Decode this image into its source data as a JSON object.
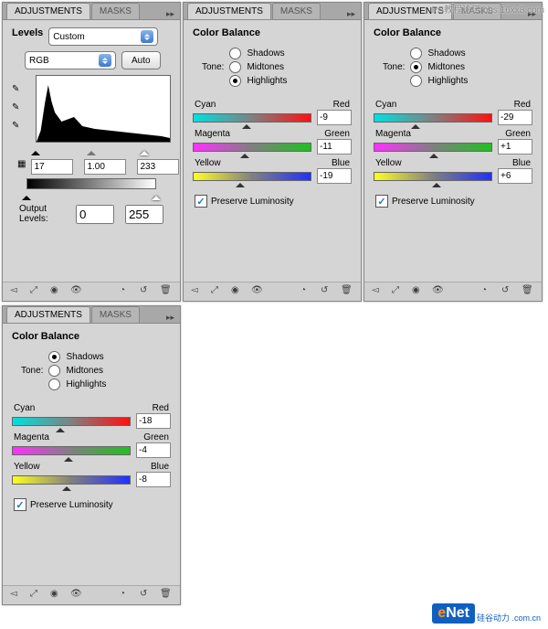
{
  "tabs": {
    "adjustments": "ADJUSTMENTS",
    "masks": "MASKS"
  },
  "panels": {
    "levels": {
      "title": "Levels",
      "preset": "Custom",
      "channel": "RGB",
      "auto": "Auto",
      "input": {
        "black": "17",
        "mid": "1.00",
        "white": "233"
      },
      "output_label": "Output Levels:",
      "output": {
        "black": "0",
        "white": "255"
      }
    },
    "cb_highlights": {
      "title": "Color Balance",
      "tone_label": "Tone:",
      "tones": {
        "shadows": "Shadows",
        "midtones": "Midtones",
        "highlights": "Highlights",
        "selected": "highlights"
      },
      "sliders": {
        "cr": {
          "left": "Cyan",
          "right": "Red",
          "value": "-9"
        },
        "mg": {
          "left": "Magenta",
          "right": "Green",
          "value": "-11"
        },
        "yb": {
          "left": "Yellow",
          "right": "Blue",
          "value": "-19"
        }
      },
      "preserve": "Preserve Luminosity"
    },
    "cb_midtones": {
      "title": "Color Balance",
      "tone_label": "Tone:",
      "tones": {
        "shadows": "Shadows",
        "midtones": "Midtones",
        "highlights": "Highlights",
        "selected": "midtones"
      },
      "sliders": {
        "cr": {
          "left": "Cyan",
          "right": "Red",
          "value": "-29"
        },
        "mg": {
          "left": "Magenta",
          "right": "Green",
          "value": "+1"
        },
        "yb": {
          "left": "Yellow",
          "right": "Blue",
          "value": "+6"
        }
      },
      "preserve": "Preserve Luminosity"
    },
    "cb_shadows": {
      "title": "Color Balance",
      "tone_label": "Tone:",
      "tones": {
        "shadows": "Shadows",
        "midtones": "Midtones",
        "highlights": "Highlights",
        "selected": "shadows"
      },
      "sliders": {
        "cr": {
          "left": "Cyan",
          "right": "Red",
          "value": "-18"
        },
        "mg": {
          "left": "Magenta",
          "right": "Green",
          "value": "-4"
        },
        "yb": {
          "left": "Yellow",
          "right": "Blue",
          "value": "-8"
        }
      },
      "preserve": "Preserve Luminosity"
    }
  },
  "watermark": "PS教程论坛 bbs.16xx8.com",
  "brand": {
    "e": "e",
    "net": "Net",
    "cn": "硅谷动力 .com.cn"
  }
}
